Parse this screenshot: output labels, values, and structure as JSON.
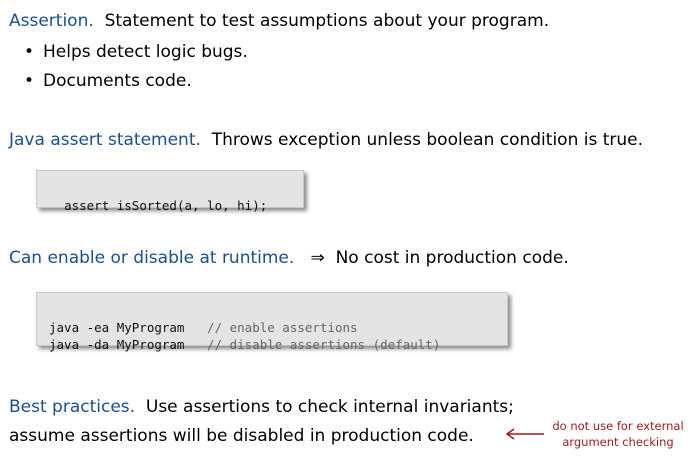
{
  "assertion": {
    "term": "Assertion.",
    "text": "Statement to test assumptions about your program.",
    "bullets": [
      "Helps detect logic bugs.",
      "Documents code."
    ]
  },
  "java_assert": {
    "term": "Java assert statement.",
    "text": "Throws exception unless boolean condition is true.",
    "code": "assert isSorted(a, lo, hi);"
  },
  "runtime": {
    "term": "Can enable or disable at runtime.",
    "arrow": "⇒",
    "text": "No cost in production code.",
    "code_lines": [
      {
        "cmd": "java -ea MyProgram",
        "comment": "// enable assertions"
      },
      {
        "cmd": "java -da MyProgram",
        "comment": "// disable assertions (default)"
      }
    ]
  },
  "best_practices": {
    "term": "Best practices.",
    "text1": "Use assertions to check internal invariants;",
    "text2": "assume assertions will be disabled in production code."
  },
  "note": {
    "line1": "do not use for external",
    "line2": "argument checking",
    "color": "#9b1c1c"
  },
  "colors": {
    "term": "#1a4f8f",
    "code_bg": "#e4e4e4"
  }
}
